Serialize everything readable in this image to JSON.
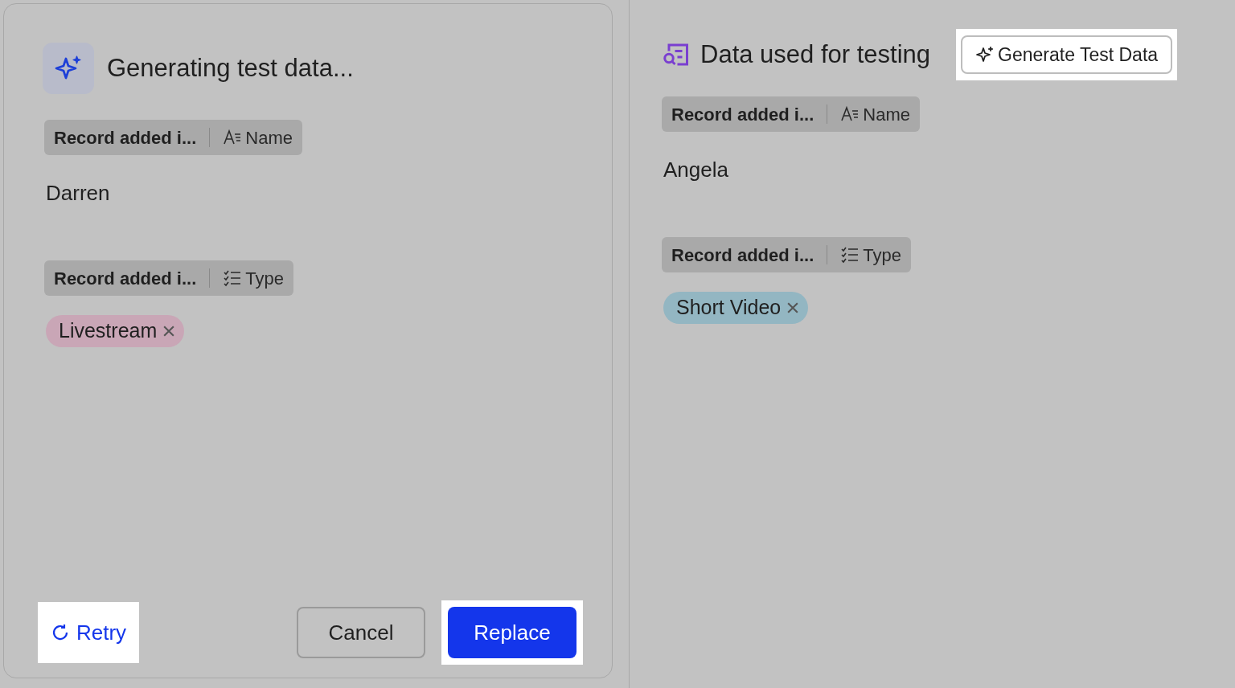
{
  "popover": {
    "title": "Generating test data...",
    "fields": [
      {
        "source": "Record added i...",
        "kind": "text",
        "field": "Name",
        "value": "Darren"
      },
      {
        "source": "Record added i...",
        "kind": "select",
        "field": "Type",
        "tag": "Livestream",
        "color": "#c9a6b6"
      }
    ],
    "buttons": [
      {
        "label": "Retry",
        "kind": "link",
        "highlighted": true
      },
      {
        "label": "Cancel",
        "kind": "secondary",
        "highlighted": false
      },
      {
        "label": "Replace",
        "kind": "primary",
        "highlighted": true
      }
    ]
  },
  "panel": {
    "title": "Data used for testing",
    "action": {
      "label": "Generate Test Data",
      "highlighted": true
    },
    "fields": [
      {
        "source": "Record added i...",
        "kind": "text",
        "field": "Name",
        "value": "Angela"
      },
      {
        "source": "Record added i...",
        "kind": "select",
        "field": "Type",
        "tag": "Short Video",
        "color": "#93b6c2"
      }
    ]
  }
}
